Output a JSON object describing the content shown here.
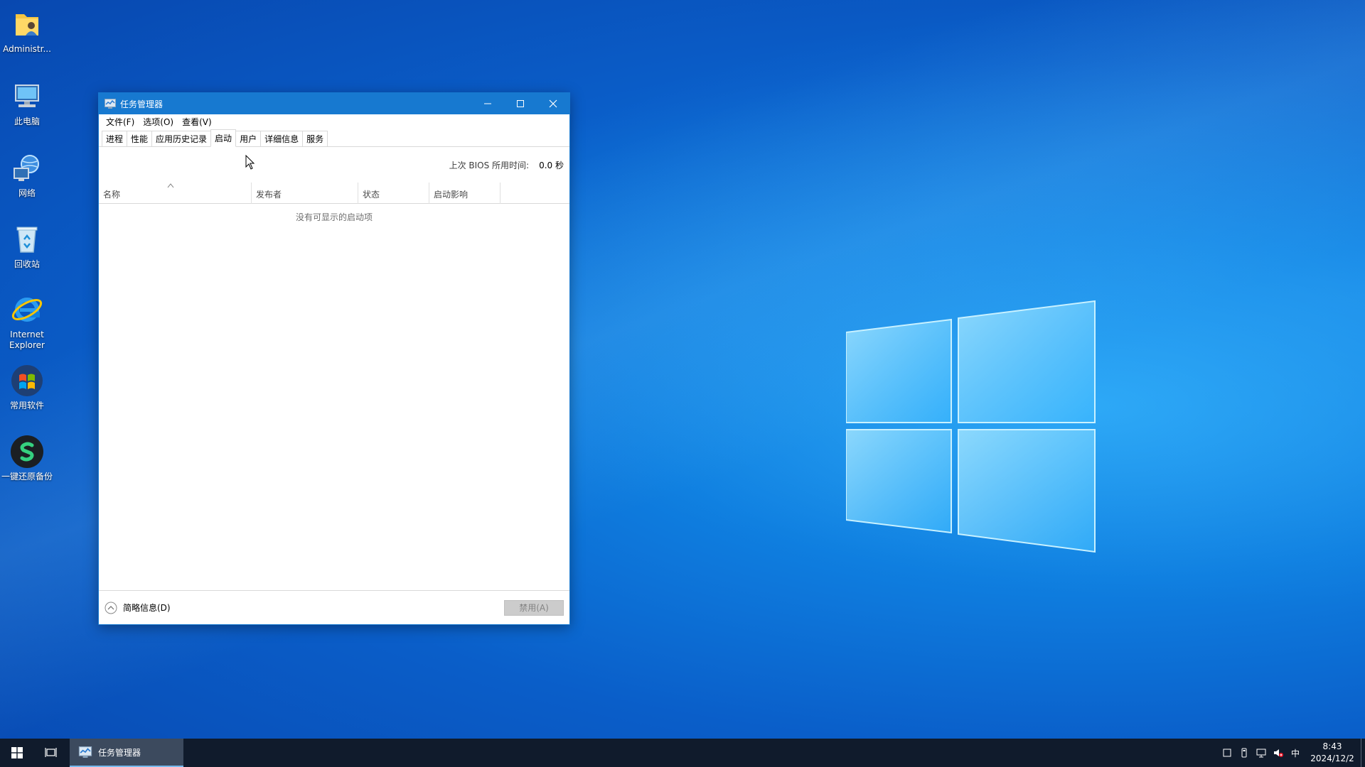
{
  "desktop": {
    "icons": [
      {
        "label": "Administr...",
        "icon": "user-folder-icon"
      },
      {
        "label": "此电脑",
        "icon": "computer-icon"
      },
      {
        "label": "网络",
        "icon": "network-icon"
      },
      {
        "label": "回收站",
        "icon": "recycle-bin-icon"
      },
      {
        "label": "Internet Explorer",
        "icon": "internet-explorer-icon"
      },
      {
        "label": "常用软件",
        "icon": "windows-flag-icon"
      },
      {
        "label": "一键还原备份",
        "icon": "restore-backup-icon"
      }
    ]
  },
  "window": {
    "title": "任务管理器",
    "menu": [
      "文件(F)",
      "选项(O)",
      "查看(V)"
    ],
    "tabs": [
      "进程",
      "性能",
      "应用历史记录",
      "启动",
      "用户",
      "详细信息",
      "服务"
    ],
    "active_tab": "启动",
    "bios_label": "上次 BIOS 所用时间:",
    "bios_value": "0.0 秒",
    "columns": [
      "名称",
      "发布者",
      "状态",
      "启动影响"
    ],
    "empty_message": "没有可显示的启动项",
    "fewer_details": "简略信息(D)",
    "disable_button": "禁用(A)"
  },
  "taskbar": {
    "running_app": "任务管理器",
    "ime": "中",
    "time": "8:43",
    "date": "2024/12/2"
  },
  "colors": {
    "title_bar": "#1779d0",
    "taskbar": "#101b2c",
    "desktop_accent": "#0f7fe0"
  }
}
